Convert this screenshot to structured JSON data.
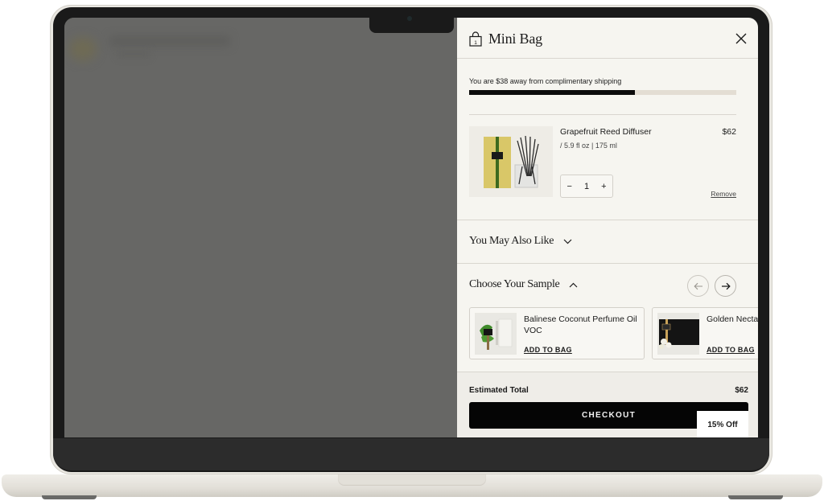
{
  "header": {
    "title": "Mini Bag",
    "bag_count": "1",
    "icons": {
      "bag": "shopping-bag-icon",
      "close": "close-icon"
    }
  },
  "shipping": {
    "message": "You are $38 away from complimentary shipping",
    "progress_percent": 62
  },
  "cart": {
    "items": [
      {
        "name": "Grapefruit Reed Diffuser",
        "size": "/ 5.9 fl oz | 175 ml",
        "price": "$62",
        "quantity": "1",
        "decrement": "−",
        "increment": "+",
        "remove_label": "Remove"
      }
    ]
  },
  "sections": {
    "you_may_also_like": "You May Also Like",
    "choose_sample": "Choose Your Sample"
  },
  "samples": [
    {
      "name": "Balinese Coconut Perfume Oil VOC",
      "add_label": "ADD TO BAG"
    },
    {
      "name": "Golden Nectar Parfum VOC",
      "add_label": "ADD TO BAG"
    }
  ],
  "footer": {
    "estimated_total_label": "Estimated Total",
    "estimated_total_value": "$62",
    "checkout_label": "CHECKOUT",
    "promo_label": "15% Off"
  },
  "colors": {
    "panel_bg": "#f6f5f0",
    "accent": "#050505",
    "progress_track": "#e3ddd3",
    "overlay": "#676765"
  }
}
